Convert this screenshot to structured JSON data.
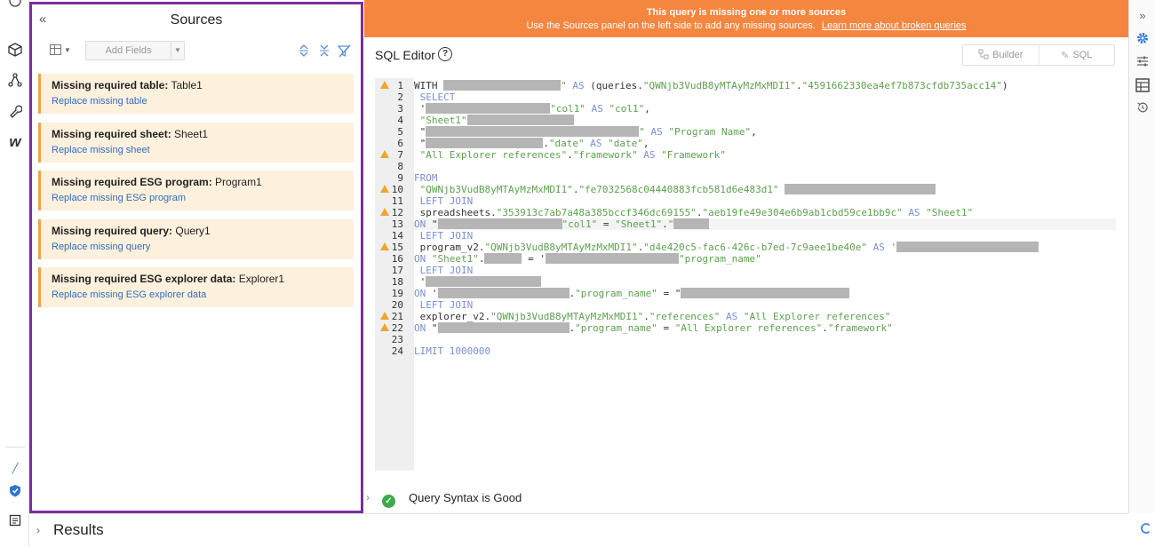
{
  "sources_panel": {
    "title": "Sources",
    "add_fields_label": "Add Fields",
    "items": [
      {
        "prefix": "Missing required table:",
        "name": "Table1",
        "link": "Replace missing table"
      },
      {
        "prefix": "Missing required sheet:",
        "name": "Sheet1",
        "link": "Replace missing sheet"
      },
      {
        "prefix": "Missing required ESG program:",
        "name": "Program1",
        "link": "Replace missing ESG program"
      },
      {
        "prefix": "Missing required query:",
        "name": "Query1",
        "link": "Replace missing query"
      },
      {
        "prefix": "Missing required ESG explorer data:",
        "name": "Explorer1",
        "link": "Replace missing ESG explorer data"
      }
    ]
  },
  "banner": {
    "line1": "This query is missing one or more sources",
    "line2": "Use the Sources panel on the left side to add any missing sources.",
    "link": "Learn more about broken queries"
  },
  "editor": {
    "title": "SQL Editor",
    "help": "?",
    "mode_builder": "Builder",
    "mode_sql": "SQL",
    "warning_lines": [
      1,
      7,
      10,
      12,
      15,
      21,
      22
    ],
    "active_line": 13,
    "lines": [
      [
        {
          "k": "p",
          "t": "WITH "
        },
        {
          "k": "r",
          "w": 132
        },
        {
          "k": "s",
          "t": "\" "
        },
        {
          "k": "kw",
          "t": "AS "
        },
        {
          "k": "p",
          "t": "(queries."
        },
        {
          "k": "s",
          "t": "\"QWNjb3VudB8yMTAyMzMxMDI1\""
        },
        {
          "k": "p",
          "t": "."
        },
        {
          "k": "s",
          "t": "\"4591662330ea4ef7b873cfdb735acc14\""
        },
        {
          "k": "p",
          "t": ")"
        }
      ],
      [
        {
          "k": "kw",
          "t": " SELECT"
        }
      ],
      [
        {
          "k": "p",
          "t": " '"
        },
        {
          "k": "r",
          "w": 140
        },
        {
          "k": "s",
          "t": "\"col1\" "
        },
        {
          "k": "kw",
          "t": "AS "
        },
        {
          "k": "s",
          "t": "\"col1\""
        },
        {
          "k": "p",
          "t": ","
        }
      ],
      [
        {
          "k": "s",
          "t": " \"Sheet1\""
        },
        {
          "k": "r",
          "w": 120
        }
      ],
      [
        {
          "k": "p",
          "t": " \""
        },
        {
          "k": "r",
          "w": 240
        },
        {
          "k": "s",
          "t": "\" "
        },
        {
          "k": "kw",
          "t": "AS "
        },
        {
          "k": "s",
          "t": "\"Program Name\""
        },
        {
          "k": "p",
          "t": ","
        }
      ],
      [
        {
          "k": "p",
          "t": " \""
        },
        {
          "k": "r",
          "w": 132
        },
        {
          "k": "p",
          "t": "."
        },
        {
          "k": "s",
          "t": "\"date\" "
        },
        {
          "k": "kw",
          "t": "AS "
        },
        {
          "k": "s",
          "t": "\"date\""
        },
        {
          "k": "p",
          "t": ","
        }
      ],
      [
        {
          "k": "s",
          "t": " \"All Explorer references\""
        },
        {
          "k": "p",
          "t": "."
        },
        {
          "k": "s",
          "t": "\"framework\" "
        },
        {
          "k": "kw",
          "t": "AS "
        },
        {
          "k": "s",
          "t": "\"Framework\""
        }
      ],
      [],
      [
        {
          "k": "kw",
          "t": "FROM"
        }
      ],
      [
        {
          "k": "s",
          "t": " \"QWNjb3VudB8yMTAyMzMxMDI1\""
        },
        {
          "k": "p",
          "t": "."
        },
        {
          "k": "s",
          "t": "\"fe7032568c04440883fcb581d6e483d1\" "
        },
        {
          "k": "r",
          "w": 170
        }
      ],
      [
        {
          "k": "kw",
          "t": " LEFT JOIN"
        }
      ],
      [
        {
          "k": "p",
          "t": " spreadsheets."
        },
        {
          "k": "s",
          "t": "\"353913c7ab7a48a385bccf346dc69155\""
        },
        {
          "k": "p",
          "t": "."
        },
        {
          "k": "s",
          "t": "\"aeb19fe49e304e6b9ab1cbd59ce1bb9c\" "
        },
        {
          "k": "kw",
          "t": "AS "
        },
        {
          "k": "s",
          "t": "\"Sheet1\""
        }
      ],
      [
        {
          "k": "kw",
          "t": "ON "
        },
        {
          "k": "p",
          "t": "\""
        },
        {
          "k": "r",
          "w": 140
        },
        {
          "k": "s",
          "t": "\"col1\" "
        },
        {
          "k": "p",
          "t": "= "
        },
        {
          "k": "s",
          "t": "\"Sheet1\""
        },
        {
          "k": "p",
          "t": "."
        },
        {
          "k": "s",
          "t": "\""
        },
        {
          "k": "r",
          "w": 40
        }
      ],
      [
        {
          "k": "kw",
          "t": " LEFT JOIN"
        }
      ],
      [
        {
          "k": "p",
          "t": " program_v2."
        },
        {
          "k": "s",
          "t": "\"QWNjb3VudB8yMTAyMzMxMDI1\""
        },
        {
          "k": "p",
          "t": "."
        },
        {
          "k": "s",
          "t": "\"d4e420c5-fac6-426c-b7ed-7c9aee1be40e\" "
        },
        {
          "k": "kw",
          "t": "AS "
        },
        {
          "k": "s",
          "t": "'"
        },
        {
          "k": "r",
          "w": 160
        }
      ],
      [
        {
          "k": "kw",
          "t": "ON "
        },
        {
          "k": "s",
          "t": "\"Sheet1\""
        },
        {
          "k": "p",
          "t": "."
        },
        {
          "k": "r",
          "w": 42
        },
        {
          "k": "p",
          "t": " = '"
        },
        {
          "k": "r",
          "w": 150
        },
        {
          "k": "s",
          "t": "\"program_name\""
        }
      ],
      [
        {
          "k": "kw",
          "t": " LEFT JOIN"
        }
      ],
      [
        {
          "k": "p",
          "t": " '"
        },
        {
          "k": "r",
          "w": 130
        }
      ],
      [
        {
          "k": "kw",
          "t": "ON "
        },
        {
          "k": "p",
          "t": "'"
        },
        {
          "k": "r",
          "w": 148
        },
        {
          "k": "p",
          "t": "."
        },
        {
          "k": "s",
          "t": "\"program_name\" "
        },
        {
          "k": "p",
          "t": "= \""
        },
        {
          "k": "r",
          "w": 190
        }
      ],
      [
        {
          "k": "kw",
          "t": " LEFT JOIN"
        }
      ],
      [
        {
          "k": "p",
          "t": " explorer_v2."
        },
        {
          "k": "s",
          "t": "\"QWNjb3VudB8yMTAyMzMxMDI1\""
        },
        {
          "k": "p",
          "t": "."
        },
        {
          "k": "s",
          "t": "\"references\" "
        },
        {
          "k": "kw",
          "t": "AS "
        },
        {
          "k": "s",
          "t": "\"All Explorer references\""
        }
      ],
      [
        {
          "k": "kw",
          "t": "ON "
        },
        {
          "k": "p",
          "t": "\""
        },
        {
          "k": "r",
          "w": 148
        },
        {
          "k": "p",
          "t": "."
        },
        {
          "k": "s",
          "t": "\"program_name\" "
        },
        {
          "k": "p",
          "t": "= "
        },
        {
          "k": "s",
          "t": "\"All Explorer references\""
        },
        {
          "k": "p",
          "t": "."
        },
        {
          "k": "s",
          "t": "\"framework\""
        }
      ],
      [],
      [
        {
          "k": "kw",
          "t": "LIMIT "
        },
        {
          "k": "kw",
          "t": "1000000"
        }
      ]
    ]
  },
  "status": {
    "text": "Query Syntax is Good"
  },
  "results": {
    "title": "Results"
  },
  "colors": {
    "banner": "#f4863f",
    "panel_border": "#7a2f9e",
    "card_bg": "#fdf1dd",
    "link": "#2f6ebf",
    "ok": "#3fa84a",
    "accent": "#2f78d1"
  },
  "icons": {
    "left_rail": [
      "cube-icon",
      "graph-icon",
      "wrench-icon",
      "w-logo-icon",
      "pen-icon",
      "shield-check-icon",
      "document-icon"
    ],
    "right_rail": [
      "expand-icon",
      "gear-icon",
      "sliders-icon",
      "table-icon",
      "history-icon"
    ]
  }
}
